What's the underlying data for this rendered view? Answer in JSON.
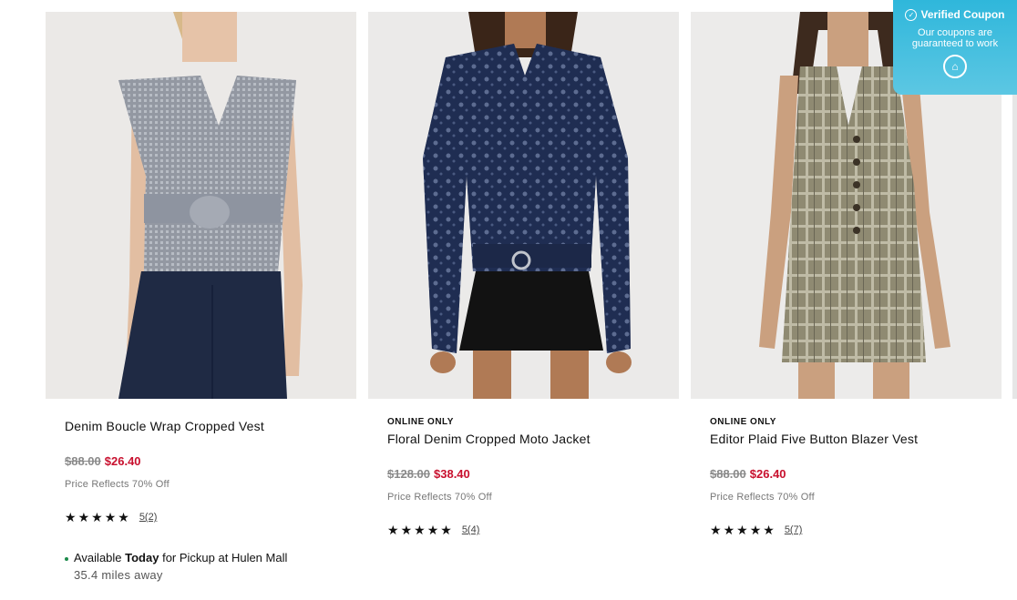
{
  "products": [
    {
      "online_only": "",
      "title": "Denim Boucle Wrap Cropped Vest",
      "price_original": "$88.00",
      "price_sale": "$26.40",
      "price_note": "Price Reflects 70% Off",
      "rating": 5,
      "rating_text": "5(2)",
      "pickup_prefix": "Available ",
      "pickup_bold": "Today",
      "pickup_suffix": " for Pickup at Hulen Mall",
      "distance": "35.4 miles away"
    },
    {
      "online_only": "ONLINE ONLY",
      "title": "Floral Denim Cropped Moto Jacket",
      "price_original": "$128.00",
      "price_sale": "$38.40",
      "price_note": "Price Reflects 70% Off",
      "rating": 5,
      "rating_text": "5(4)"
    },
    {
      "online_only": "ONLINE ONLY",
      "title": "Editor Plaid Five Button Blazer Vest",
      "price_original": "$88.00",
      "price_sale": "$26.40",
      "price_note": "Price Reflects 70% Off",
      "rating": 5,
      "rating_text": "5(7)"
    }
  ],
  "coupon": {
    "title": "Verified Coupon",
    "subtitle": "Our coupons are guaranteed to work"
  },
  "colors": {
    "sale": "#c8102e",
    "coupon_bg": "#2fb7db",
    "pickup_dot": "#1b8a4a"
  }
}
